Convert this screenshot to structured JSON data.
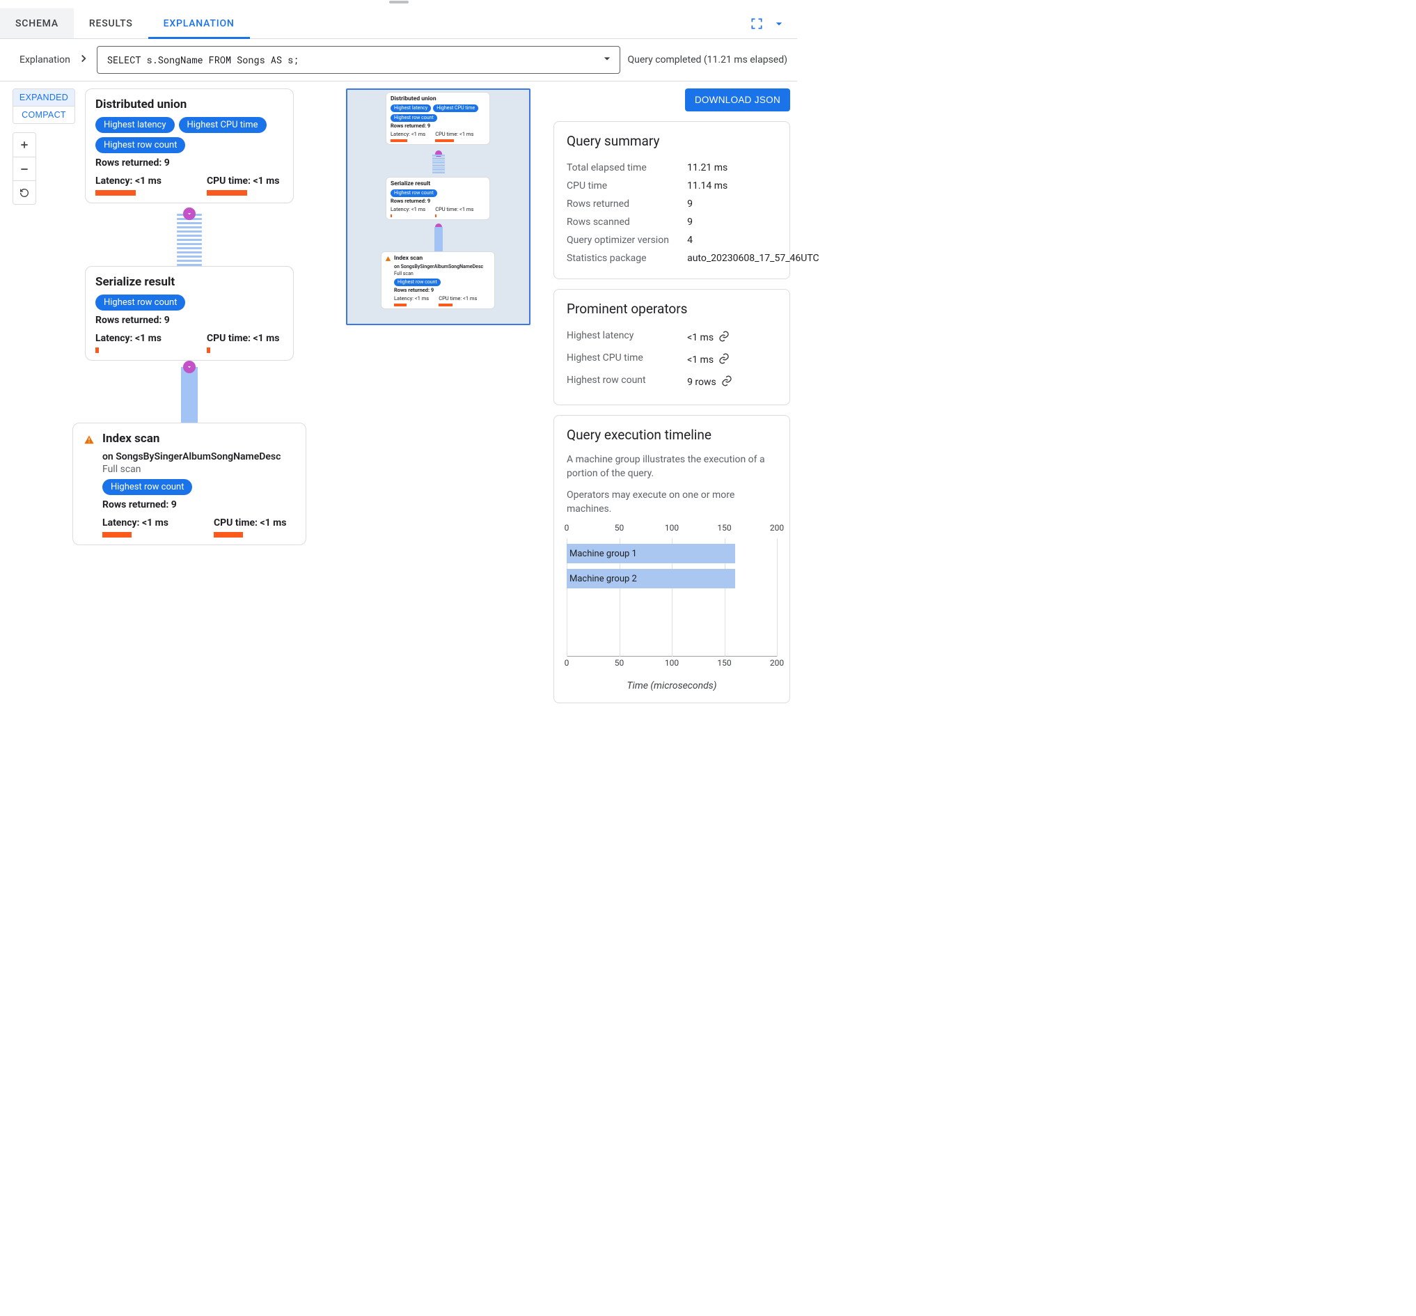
{
  "tabs": {
    "schema": "SCHEMA",
    "results": "RESULTS",
    "explanation": "EXPLANATION"
  },
  "crumb": "Explanation",
  "query": "SELECT s.SongName FROM Songs AS s;",
  "status_text": "Query completed (11.21 ms elapsed)",
  "left": {
    "expanded": "EXPANDED",
    "compact": "COMPACT"
  },
  "download_button": "DOWNLOAD JSON",
  "nodes": {
    "n1": {
      "title": "Distributed union",
      "chips": [
        "Highest latency",
        "Highest CPU time",
        "Highest row count"
      ],
      "rows": "Rows returned: 9",
      "lat_label": "Latency: <1 ms",
      "cpu_label": "CPU time: <1 ms",
      "lat_fill_pct": 48,
      "cpu_fill_pct": 48
    },
    "n2": {
      "title": "Serialize result",
      "chips": [
        "Highest row count"
      ],
      "rows": "Rows returned: 9",
      "lat_label": "Latency: <1 ms",
      "cpu_label": "CPU time: <1 ms",
      "lat_fill_pct": 4,
      "cpu_fill_pct": 4
    },
    "n3": {
      "title": "Index scan",
      "sub_on": "on SongsBySingerAlbumSongNameDesc",
      "sub_note": "Full scan",
      "chips": [
        "Highest row count"
      ],
      "rows": "Rows returned: 9",
      "lat_label": "Latency: <1 ms",
      "cpu_label": "CPU time: <1 ms",
      "lat_fill_pct": 35,
      "cpu_fill_pct": 35
    }
  },
  "summary": {
    "title": "Query summary",
    "rows": [
      {
        "k": "Total elapsed time",
        "v": "11.21 ms"
      },
      {
        "k": "CPU time",
        "v": "11.14 ms"
      },
      {
        "k": "Rows returned",
        "v": "9"
      },
      {
        "k": "Rows scanned",
        "v": "9"
      },
      {
        "k": "Query optimizer version",
        "v": "4"
      },
      {
        "k": "Statistics package",
        "v": "auto_20230608_17_57_46UTC"
      }
    ]
  },
  "prominent": {
    "title": "Prominent operators",
    "rows": [
      {
        "k": "Highest latency",
        "v": "<1 ms"
      },
      {
        "k": "Highest CPU time",
        "v": "<1 ms"
      },
      {
        "k": "Highest row count",
        "v": "9 rows"
      }
    ]
  },
  "timeline": {
    "title": "Query execution timeline",
    "desc1": "A machine group illustrates the execution of a portion of the query.",
    "desc2": "Operators may execute on one or more machines.",
    "xlabel": "Time (microseconds)"
  },
  "chart_data": {
    "type": "bar",
    "orientation": "horizontal",
    "categories": [
      "Machine group 1",
      "Machine group 2"
    ],
    "values": [
      160,
      160
    ],
    "xlabel": "Time (microseconds)",
    "ylabel": "",
    "xlim": [
      0,
      200
    ],
    "ticks": [
      0,
      50,
      100,
      150,
      200
    ]
  }
}
